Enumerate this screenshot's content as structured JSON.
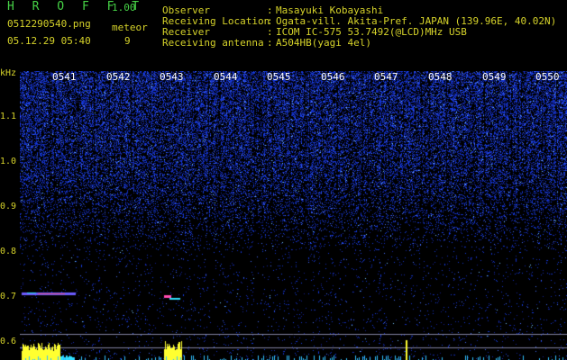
{
  "header": {
    "app_title": "H R O F F T",
    "version": "1.00",
    "filename": "0512290540.png",
    "timestamp": "05.12.29 05:40",
    "mode_label": "meteor",
    "count": "9",
    "info": [
      {
        "label": "Observer",
        "value": "Masayuki Kobayashi"
      },
      {
        "label": "Receiving Location",
        "value": "Ogata-vill. Akita-Pref. JAPAN (139.96E, 40.02N)"
      },
      {
        "label": "Receiver",
        "value": "ICOM IC-575 53.7492(@LCD)MHz USB"
      },
      {
        "label": "Receiving antenna",
        "value": "A504HB(yagi 4el)"
      }
    ]
  },
  "axis": {
    "unit": "kHz",
    "y_ticks": [
      "1.1",
      "1.0",
      "0.9",
      "0.8",
      "0.7",
      "0.6"
    ],
    "x_ticks": [
      "0541",
      "0542",
      "0543",
      "0544",
      "0545",
      "0546",
      "0547",
      "0548",
      "0549",
      "0550"
    ]
  },
  "colors": {
    "header_green": "#46d246",
    "header_yellow": "#d6d32a",
    "noise_blue": "#3a54ff",
    "trace_yellow": "#ffff30",
    "trace_cyan": "#30e0ff"
  }
}
